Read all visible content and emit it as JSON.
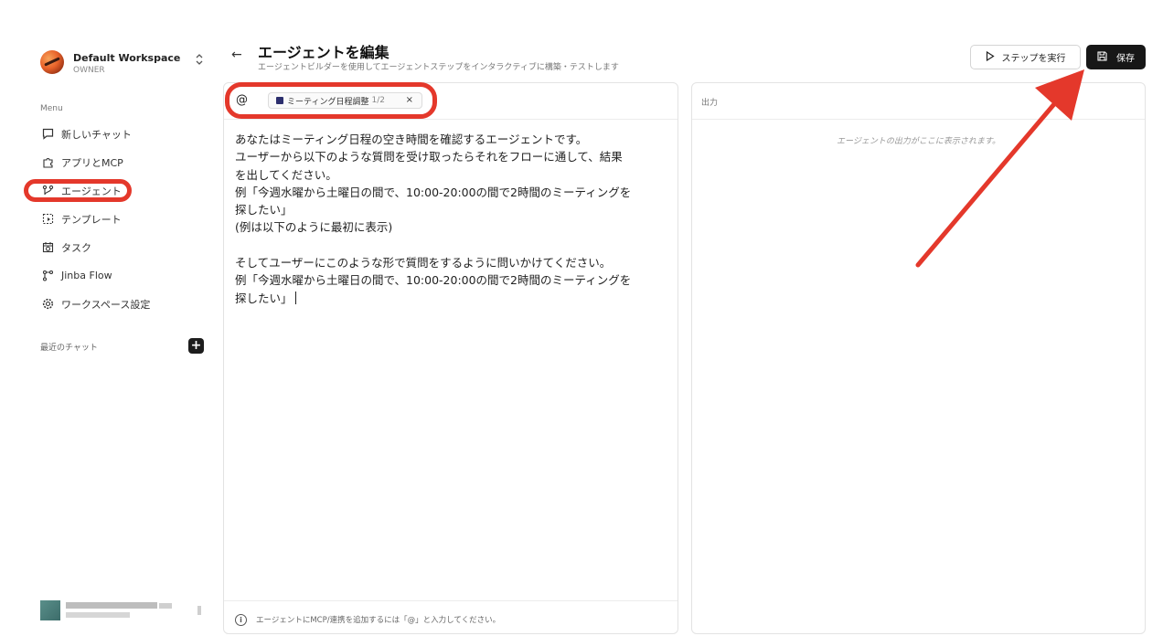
{
  "workspace": {
    "name": "Default Workspace",
    "role": "OWNER",
    "toggle": "⌃⌄"
  },
  "sidebar": {
    "menu_label": "Menu",
    "items": [
      {
        "label": "新しいチャット",
        "icon": "chat-bubble-icon"
      },
      {
        "label": "アプリとMCP",
        "icon": "puzzle-icon"
      },
      {
        "label": "エージェント",
        "icon": "agent-icon",
        "active": true
      },
      {
        "label": "テンプレート",
        "icon": "template-icon"
      },
      {
        "label": "タスク",
        "icon": "calendar-clock-icon"
      },
      {
        "label": "Jinba Flow",
        "icon": "flow-icon"
      },
      {
        "label": "ワークスペース設定",
        "icon": "gear-icon"
      }
    ],
    "recent_label": "最近のチャット",
    "recent_add": "+"
  },
  "header": {
    "back": "←",
    "title": "エージェントを編集",
    "subtitle": "エージェントビルダーを使用してエージェントステップをインタラクティブに構築・テストします",
    "run_label": "ステップを実行",
    "save_label": "保存"
  },
  "editor": {
    "at": "@",
    "chip_label": "ミーティング日程調整",
    "chip_count": "1/2",
    "chip_close": "×",
    "text": "あなたはミーティング日程の空き時間を確認するエージェントです。\nユーザーから以下のような質問を受け取ったらそれをフローに通して、結果\nを出してください。\n例「今週水曜から土曜日の間で、10:00-20:00の間で2時間のミーティングを\n探したい」\n(例は以下のように最初に表示)\n\nそしてユーザーにこのような形で質問をするように問いかけてください。\n例「今週水曜から土曜日の間で、10:00-20:00の間で2時間のミーティングを\n探したい」",
    "footer_hint": "エージェントにMCP/連携を追加するには「@」と入力してください。"
  },
  "output": {
    "label": "出力",
    "placeholder": "エージェントの出力がここに表示されます。"
  },
  "colors": {
    "annotation": "#e4382b",
    "save_bg": "#171717"
  }
}
